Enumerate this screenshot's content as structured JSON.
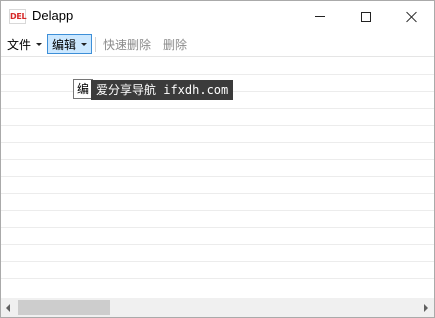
{
  "window": {
    "title": "Delapp",
    "icon_label": "DEL",
    "icon": "app-del-icon"
  },
  "caption_buttons": {
    "minimize_icon": "minimize-icon",
    "maximize_icon": "maximize-icon",
    "close_icon": "close-icon"
  },
  "menu": {
    "file_label": "文件",
    "edit_label": "编辑",
    "quick_delete_label": "快速删除",
    "delete_label": "删除"
  },
  "tooltip": {
    "text": "编"
  },
  "watermark": {
    "text": "爱分享导航 ifxdh.com"
  },
  "colors": {
    "menu_highlight": "#cce8ff",
    "menu_highlight_border": "#3d8fd8",
    "disabled_text": "#8a8a8a",
    "watermark_bg": "#3b3b3b"
  }
}
